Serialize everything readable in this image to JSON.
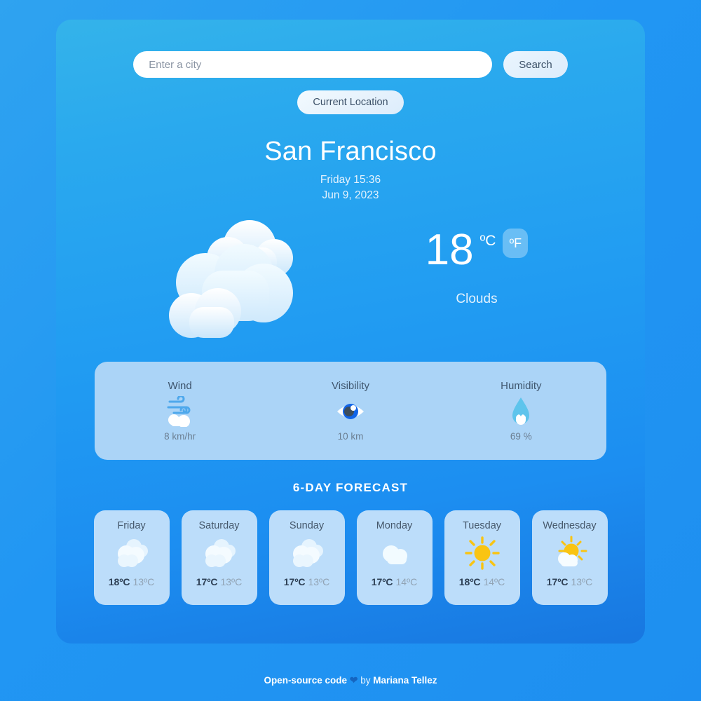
{
  "search": {
    "placeholder": "Enter a city",
    "value": "",
    "search_label": "Search",
    "current_location_label": "Current Location"
  },
  "location": {
    "city": "San Francisco",
    "time": "Friday 15:36",
    "date": "Jun 9, 2023"
  },
  "current": {
    "temperature": "18",
    "unit": "ºC",
    "toggle_unit": "ºF",
    "description": "Clouds",
    "icon": "clouds-icon"
  },
  "stats": [
    {
      "label": "Wind",
      "value": "8 km/hr",
      "icon": "wind-icon"
    },
    {
      "label": "Visibility",
      "value": "10 km",
      "icon": "eye-icon"
    },
    {
      "label": "Humidity",
      "value": "69 %",
      "icon": "droplet-icon"
    }
  ],
  "forecast": {
    "title": "6-DAY FORECAST",
    "days": [
      {
        "day": "Friday",
        "high": "18ºC",
        "low": "13ºC",
        "icon": "clouds-icon"
      },
      {
        "day": "Saturday",
        "high": "17ºC",
        "low": "13ºC",
        "icon": "clouds-icon"
      },
      {
        "day": "Sunday",
        "high": "17ºC",
        "low": "13ºC",
        "icon": "clouds-icon"
      },
      {
        "day": "Monday",
        "high": "17ºC",
        "low": "14ºC",
        "icon": "cloud-icon"
      },
      {
        "day": "Tuesday",
        "high": "18ºC",
        "low": "14ºC",
        "icon": "sun-icon"
      },
      {
        "day": "Wednesday",
        "high": "17ºC",
        "low": "13ºC",
        "icon": "sun-cloud-icon"
      }
    ]
  },
  "footer": {
    "prefix": "Open-source code",
    "heart": "❤",
    "by": "by",
    "author": "Mariana Tellez"
  },
  "colors": {
    "page_background": "#2196f3",
    "card_top": "#34b3ea",
    "card_bottom": "#1877e0",
    "panel": "#abd4f7",
    "forecast_card": "#bcddfa",
    "accent_sun": "#f9c412"
  }
}
